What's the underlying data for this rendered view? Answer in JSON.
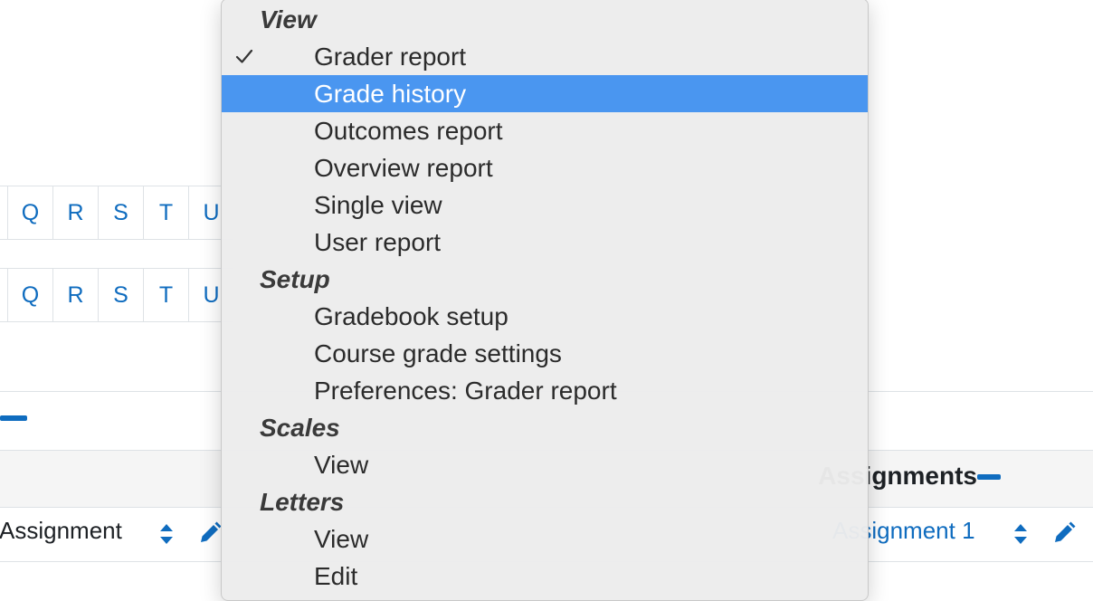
{
  "letters_row_1": [
    "Q",
    "R",
    "S",
    "T",
    "U"
  ],
  "letters_row_2": [
    "Q",
    "R",
    "S",
    "T",
    "U"
  ],
  "category_title": "Assignments",
  "column_header_left": ": Assignment",
  "column_header_right": "Assignment 1",
  "menu": {
    "groups": [
      {
        "label": "View",
        "items": [
          {
            "label": "Grader report",
            "checked": true,
            "highlighted": false
          },
          {
            "label": "Grade history",
            "checked": false,
            "highlighted": true
          },
          {
            "label": "Outcomes report",
            "checked": false,
            "highlighted": false
          },
          {
            "label": "Overview report",
            "checked": false,
            "highlighted": false
          },
          {
            "label": "Single view",
            "checked": false,
            "highlighted": false
          },
          {
            "label": "User report",
            "checked": false,
            "highlighted": false
          }
        ]
      },
      {
        "label": "Setup",
        "items": [
          {
            "label": "Gradebook setup",
            "checked": false,
            "highlighted": false
          },
          {
            "label": "Course grade settings",
            "checked": false,
            "highlighted": false
          },
          {
            "label": "Preferences: Grader report",
            "checked": false,
            "highlighted": false
          }
        ]
      },
      {
        "label": "Scales",
        "items": [
          {
            "label": "View",
            "checked": false,
            "highlighted": false
          }
        ]
      },
      {
        "label": "Letters",
        "items": [
          {
            "label": "View",
            "checked": false,
            "highlighted": false
          },
          {
            "label": "Edit",
            "checked": false,
            "highlighted": false
          }
        ]
      }
    ]
  },
  "colors": {
    "link": "#0f6cbf",
    "highlight": "#4a96f0",
    "menu_bg": "#ececec"
  }
}
